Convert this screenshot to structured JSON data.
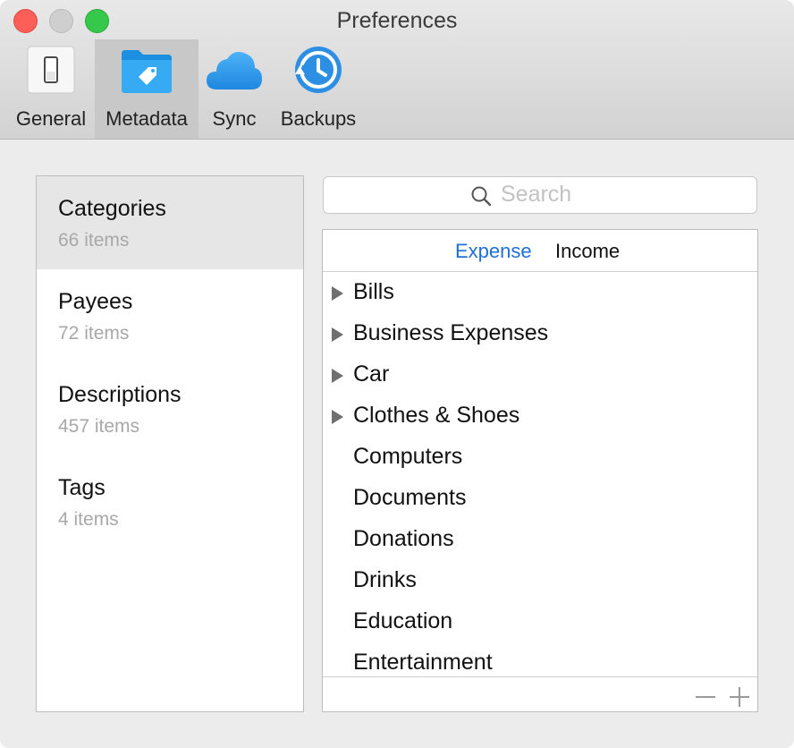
{
  "window": {
    "title": "Preferences"
  },
  "toolbar": {
    "items": [
      {
        "label": "General",
        "icon": "switch-icon",
        "selected": false
      },
      {
        "label": "Metadata",
        "icon": "folder-tag-icon",
        "selected": true
      },
      {
        "label": "Sync",
        "icon": "cloud-icon",
        "selected": false
      },
      {
        "label": "Backups",
        "icon": "time-machine-icon",
        "selected": false
      }
    ]
  },
  "sidebar": {
    "items": [
      {
        "name": "Categories",
        "count": "66 items",
        "selected": true
      },
      {
        "name": "Payees",
        "count": "72 items",
        "selected": false
      },
      {
        "name": "Descriptions",
        "count": "457 items",
        "selected": false
      },
      {
        "name": "Tags",
        "count": "4 items",
        "selected": false
      }
    ]
  },
  "search": {
    "placeholder": "Search",
    "value": ""
  },
  "segments": {
    "expense": "Expense",
    "income": "Income",
    "active": "Expense"
  },
  "categories": [
    {
      "label": "Bills",
      "expandable": true
    },
    {
      "label": "Business Expenses",
      "expandable": true
    },
    {
      "label": "Car",
      "expandable": true
    },
    {
      "label": "Clothes & Shoes",
      "expandable": true
    },
    {
      "label": "Computers",
      "expandable": false
    },
    {
      "label": "Documents",
      "expandable": false
    },
    {
      "label": "Donations",
      "expandable": false
    },
    {
      "label": "Drinks",
      "expandable": false
    },
    {
      "label": "Education",
      "expandable": false
    },
    {
      "label": "Entertainment",
      "expandable": false
    }
  ],
  "colors": {
    "accent": "#1f6fd6",
    "close": "#fc5f57",
    "minimize": "#cfcfcf",
    "zoom": "#35c84a",
    "selected_toolbar": "#c9c8c9",
    "selected_sidebar": "#e6e6e6"
  }
}
